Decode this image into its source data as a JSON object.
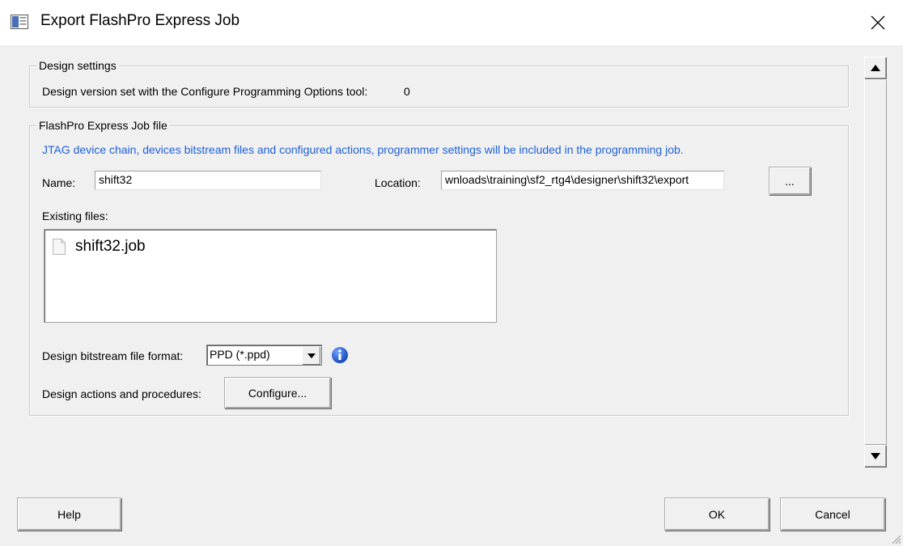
{
  "window": {
    "title": "Export FlashPro Express Job"
  },
  "design_settings": {
    "legend": "Design settings",
    "version_label": "Design version set with the Configure Programming Options tool:",
    "version_value": "0"
  },
  "job_file": {
    "legend": "FlashPro Express Job file",
    "info_text": "JTAG device chain, devices bitstream files and configured actions, programmer settings will be included in the programming job.",
    "info_color": "#1e5fd6",
    "name_label": "Name:",
    "name_value": "shift32",
    "location_label": "Location:",
    "location_value": "wnloads\\training\\sf2_rtg4\\designer\\shift32\\export",
    "browse_label": "...",
    "existing_label": "Existing files:",
    "existing_files": [
      {
        "name": "shift32.job",
        "icon": "file-icon"
      }
    ],
    "format_label": "Design bitstream file format:",
    "format_value": "PPD (*.ppd)",
    "actions_label": "Design actions and procedures:",
    "configure_label": "Configure..."
  },
  "footer": {
    "help_label": "Help",
    "ok_label": "OK",
    "cancel_label": "Cancel"
  }
}
